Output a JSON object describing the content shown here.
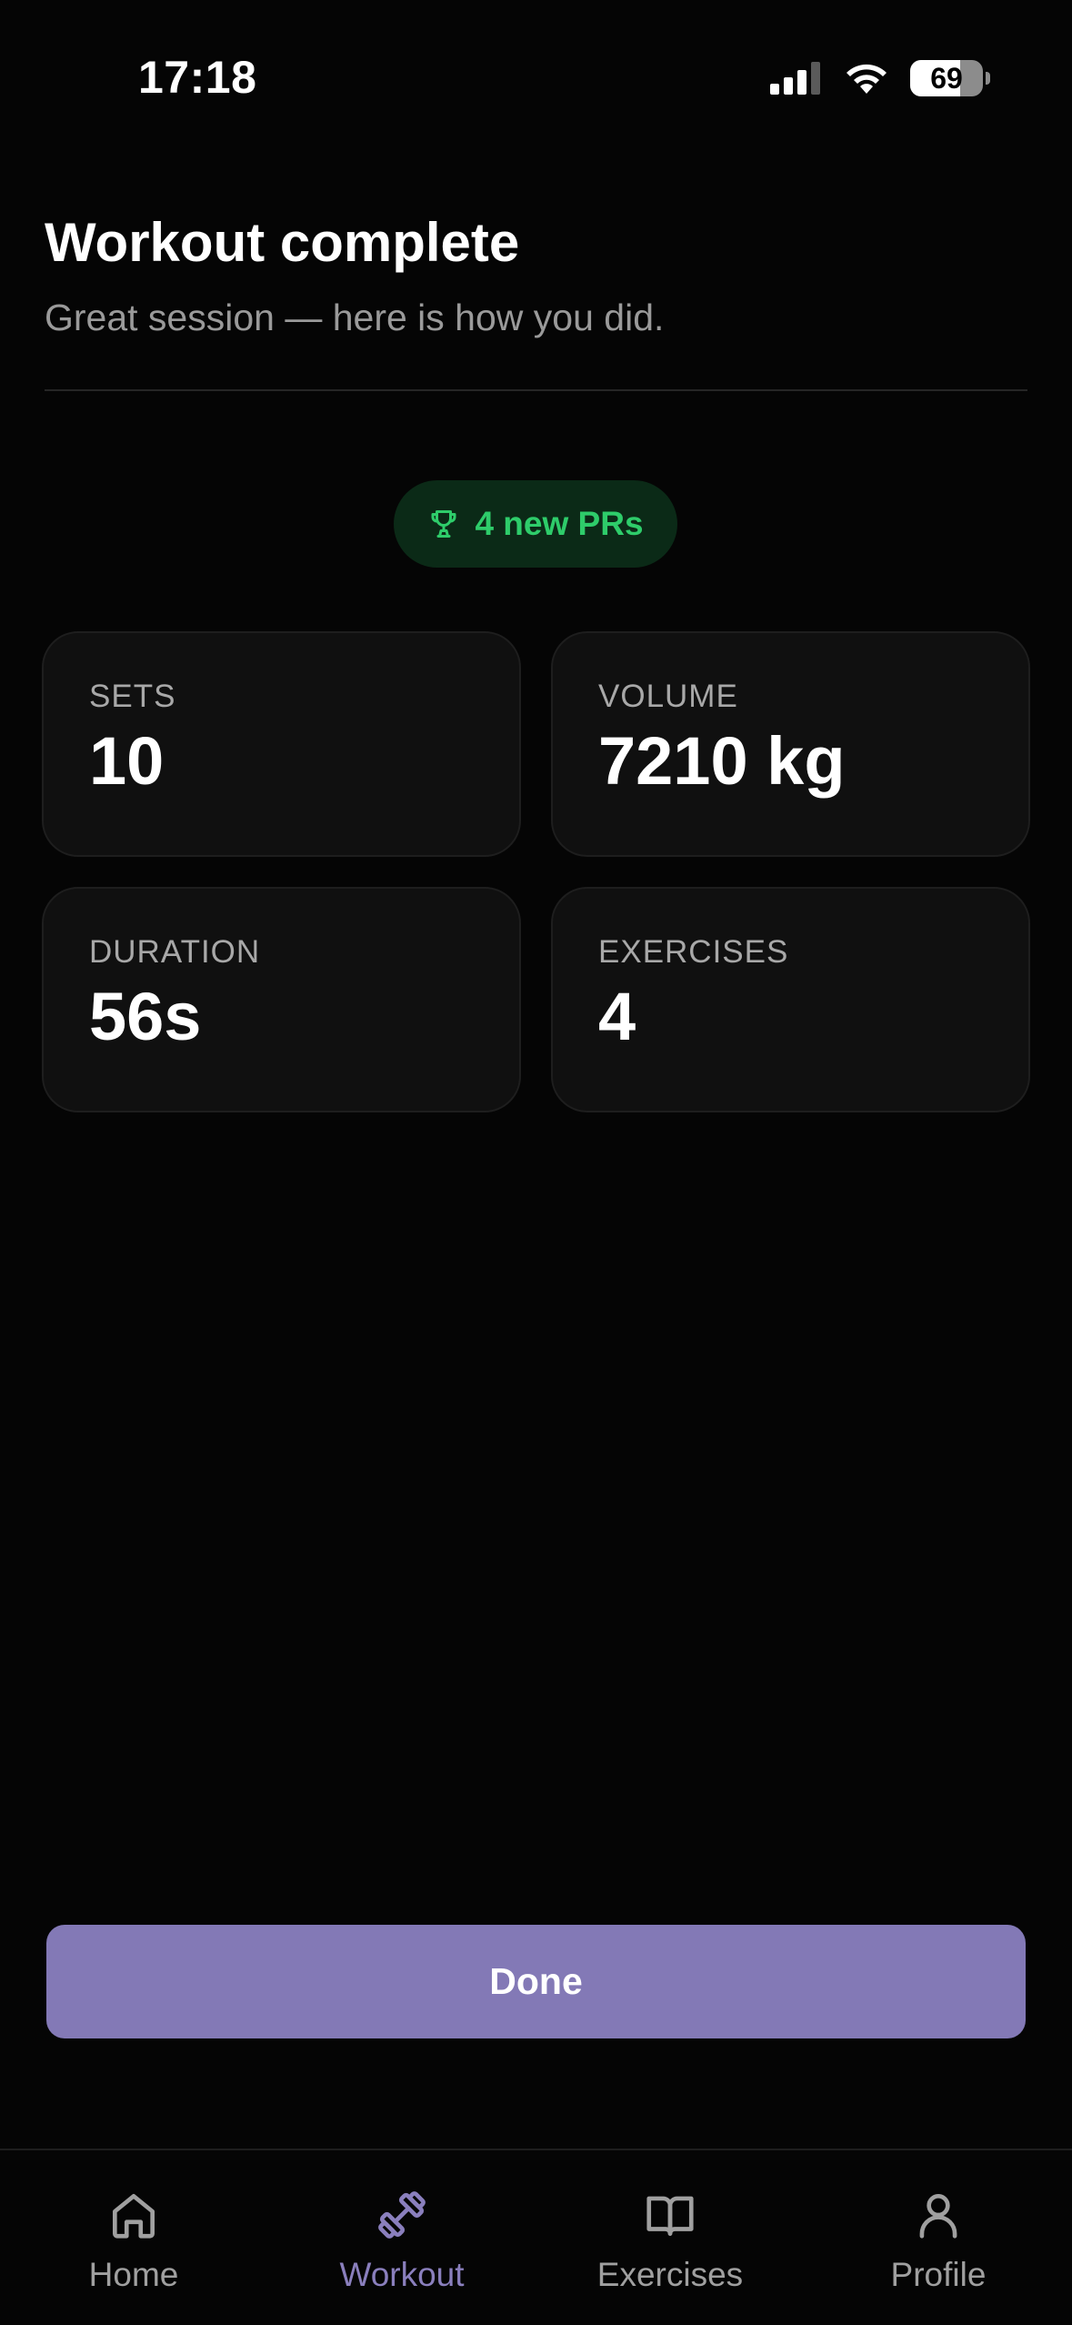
{
  "status_bar": {
    "time": "17:18",
    "battery": "69",
    "battery_level": 0.69,
    "icons": [
      "cellular-signal-icon",
      "wifi-icon",
      "battery-icon"
    ]
  },
  "header": {
    "title": "Workout complete",
    "subtitle": "Great session — here is how you did."
  },
  "pr_badge": {
    "icon": "trophy-icon",
    "label": "4 new PRs"
  },
  "stats": [
    {
      "label": "SETS",
      "value": "10"
    },
    {
      "label": "VOLUME",
      "value": "7210 kg"
    },
    {
      "label": "DURATION",
      "value": "56s"
    },
    {
      "label": "EXERCISES",
      "value": "4"
    }
  ],
  "actions": {
    "done_label": "Done"
  },
  "bottom_nav": {
    "items": [
      {
        "label": "Home",
        "icon": "home-icon",
        "active": false
      },
      {
        "label": "Workout",
        "icon": "dumbbell-icon",
        "active": true
      },
      {
        "label": "Exercises",
        "icon": "book-icon",
        "active": false
      },
      {
        "label": "Profile",
        "icon": "person-icon",
        "active": false
      }
    ]
  },
  "colors": {
    "background": "#050505",
    "accent": "#8379b6",
    "pr_green": "#2ecc6a",
    "card_bg": "#101010"
  }
}
